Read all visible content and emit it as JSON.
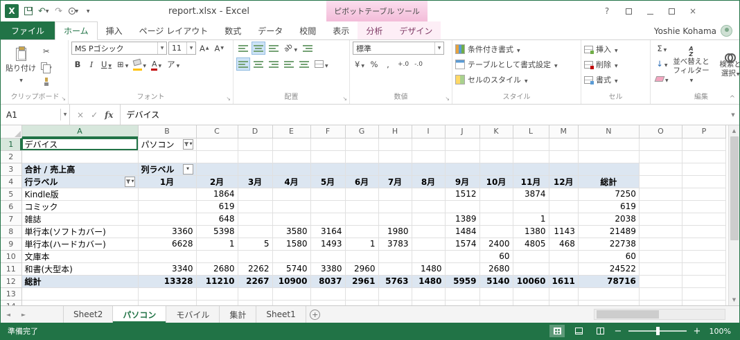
{
  "title_bar": {
    "title": "report.xlsx - Excel",
    "contextual_title": "ピボットテーブル ツール",
    "user": "Yoshie Kohama"
  },
  "ribbon_tabs": {
    "file": "ファイル",
    "main": [
      "ホーム",
      "挿入",
      "ページ レイアウト",
      "数式",
      "データ",
      "校閲",
      "表示"
    ],
    "active": "ホーム",
    "contextual": [
      "分析",
      "デザイン"
    ]
  },
  "ribbon": {
    "paste": "貼り付け",
    "font_name": "MS Pゴシック",
    "font_size": "11",
    "number_format": "標準",
    "conditional_formatting": "条件付き書式",
    "format_as_table": "テーブルとして書式設定",
    "cell_styles": "セルのスタイル",
    "insert": "挿入",
    "delete": "削除",
    "format": "書式",
    "sort_filter_line1": "並べ替えと",
    "sort_filter_line2": "フィルター",
    "find_select_line1": "検索と",
    "find_select_line2": "選択",
    "groups": {
      "clipboard": "クリップボード",
      "font": "フォント",
      "alignment": "配置",
      "number": "数値",
      "styles": "スタイル",
      "cells": "セル",
      "editing": "編集"
    }
  },
  "icons": {
    "logo": "X",
    "undo": "↶",
    "redo": "↷",
    "help": "?",
    "close": "×",
    "cut": "✂",
    "bold": "B",
    "italic": "I",
    "underline": "U",
    "font_letter": "A",
    "borders": "⊞",
    "phonetic": "ア",
    "orientation": "ab",
    "currency": "¥",
    "percent": "%",
    "comma": ",",
    "inc_decimal": "+.0",
    "dec_decimal": "-.0",
    "sigma": "Σ",
    "fill": "↓",
    "sort_a": "A",
    "sort_z": "Z",
    "cancel": "×",
    "enter": "✓",
    "new_sheet": "+",
    "zoom_in": "+",
    "zoom_out": "−",
    "collapse": "^"
  },
  "formula_bar": {
    "name_box": "A1",
    "fx": "fx",
    "value": "デバイス"
  },
  "sheet": {
    "columns": [
      "A",
      "B",
      "C",
      "D",
      "E",
      "F",
      "G",
      "H",
      "I",
      "J",
      "K",
      "L",
      "M",
      "N",
      "O",
      "P"
    ]
  },
  "pivot": {
    "page_field": "デバイス",
    "page_value": "パソコン",
    "values_label": "合計 / 売上高",
    "column_label": "列ラベル",
    "row_label": "行ラベル",
    "months": [
      "1月",
      "2月",
      "3月",
      "4月",
      "5月",
      "6月",
      "7月",
      "8月",
      "9月",
      "10月",
      "11月",
      "12月"
    ],
    "total_label": "総計",
    "rows": [
      {
        "label": "Kindle版",
        "values": [
          "",
          "1864",
          "",
          "",
          "",
          "",
          "",
          "",
          "1512",
          "",
          "3874",
          ""
        ],
        "total": "7250"
      },
      {
        "label": "コミック",
        "values": [
          "",
          "619",
          "",
          "",
          "",
          "",
          "",
          "",
          "",
          "",
          "",
          ""
        ],
        "total": "619"
      },
      {
        "label": "雑誌",
        "values": [
          "",
          "648",
          "",
          "",
          "",
          "",
          "",
          "",
          "1389",
          "",
          "1",
          ""
        ],
        "total": "2038"
      },
      {
        "label": "単行本(ソフトカバー)",
        "values": [
          "3360",
          "5398",
          "",
          "3580",
          "3164",
          "",
          "1980",
          "",
          "1484",
          "",
          "1380",
          "1143"
        ],
        "total": "21489"
      },
      {
        "label": "単行本(ハードカバー)",
        "values": [
          "6628",
          "1",
          "5",
          "1580",
          "1493",
          "1",
          "3783",
          "",
          "1574",
          "2400",
          "4805",
          "468"
        ],
        "total": "22738"
      },
      {
        "label": "文庫本",
        "values": [
          "",
          "",
          "",
          "",
          "",
          "",
          "",
          "",
          "",
          "60",
          "",
          ""
        ],
        "total": "60"
      },
      {
        "label": "和書(大型本)",
        "values": [
          "3340",
          "2680",
          "2262",
          "5740",
          "3380",
          "2960",
          "",
          "1480",
          "",
          "2680",
          "",
          ""
        ],
        "total": "24522"
      }
    ],
    "grand_total": {
      "label": "総計",
      "values": [
        "13328",
        "11210",
        "2267",
        "10900",
        "8037",
        "2961",
        "5763",
        "1480",
        "5959",
        "5140",
        "10060",
        "1611"
      ],
      "total": "78716"
    }
  },
  "sheet_tabs": {
    "tabs": [
      "Sheet2",
      "パソコン",
      "モバイル",
      "集計",
      "Sheet1"
    ],
    "active": "パソコン"
  },
  "status_bar": {
    "mode": "準備完了",
    "zoom": "100%"
  }
}
